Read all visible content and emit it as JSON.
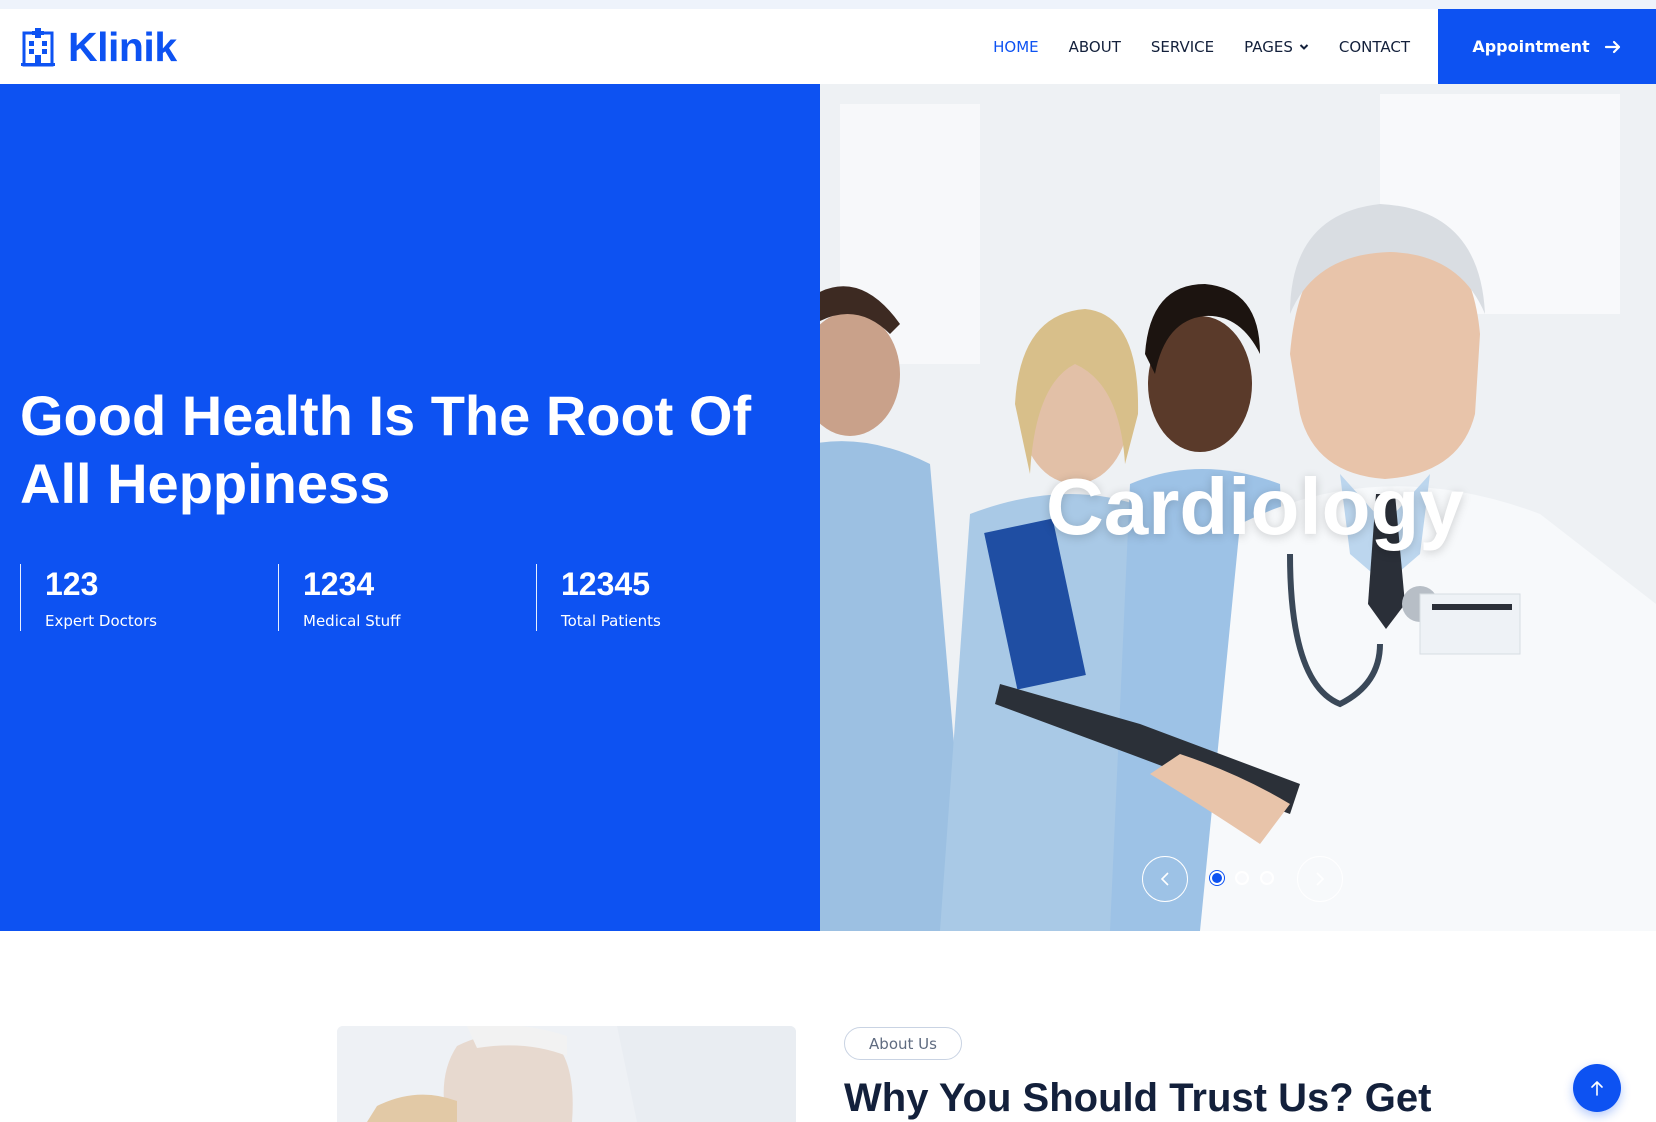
{
  "brand": {
    "name": "Klinik",
    "icon": "hospital-building-icon"
  },
  "nav": {
    "items": [
      {
        "label": "HOME",
        "active": true
      },
      {
        "label": "ABOUT",
        "active": false
      },
      {
        "label": "SERVICE",
        "active": false
      },
      {
        "label": "PAGES",
        "active": false,
        "has_dropdown": true
      },
      {
        "label": "CONTACT",
        "active": false
      }
    ],
    "appointment_label": "Appointment"
  },
  "hero": {
    "title": "Good Health Is The Root Of All Heppiness",
    "stats": [
      {
        "value": "123",
        "label": "Expert Doctors"
      },
      {
        "value": "1234",
        "label": "Medical Stuff"
      },
      {
        "value": "12345",
        "label": "Total Patients"
      }
    ],
    "slide_title": "Cardiology",
    "slides_count": 3,
    "active_slide": 1
  },
  "about": {
    "badge": "About Us",
    "heading": "Why You Should Trust Us? Get"
  },
  "colors": {
    "primary": "#0d52f2",
    "dark_text": "#13203b",
    "white": "#ffffff"
  }
}
